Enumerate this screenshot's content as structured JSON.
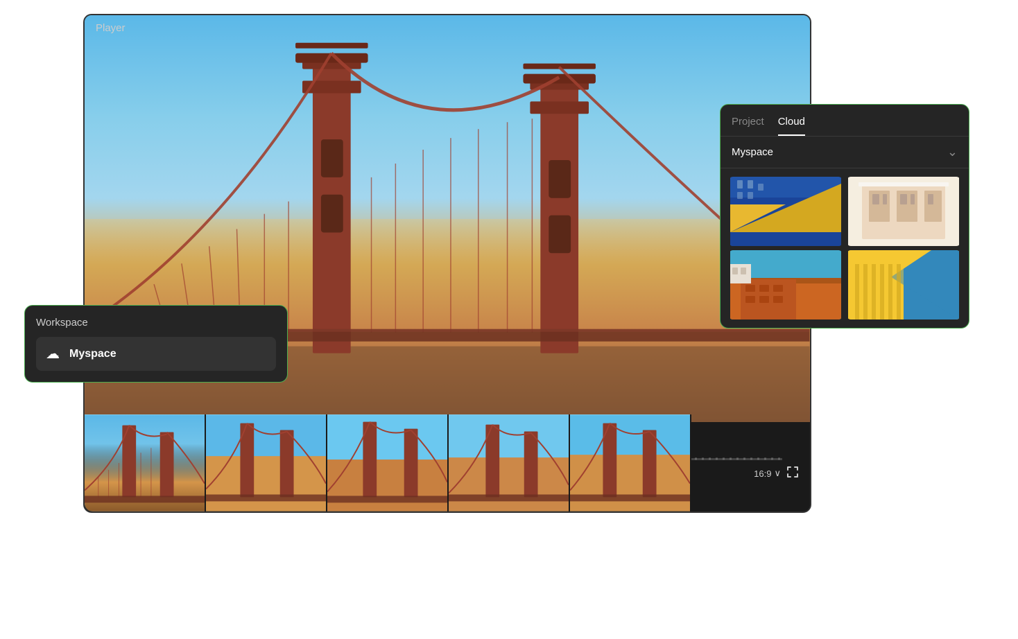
{
  "player": {
    "label": "Player"
  },
  "workspace_popup": {
    "title": "Workspace",
    "item_name": "Myspace",
    "item_icon": "☁"
  },
  "cloud_panel": {
    "tab_project": "Project",
    "tab_cloud": "Cloud",
    "dropdown_label": "Myspace",
    "dropdown_arrow": "⌄"
  },
  "timeline": {
    "aspect_ratio": "16:9",
    "aspect_chevron": "∨"
  },
  "thumbnails": [
    {
      "id": 1,
      "type": "thumb-1"
    },
    {
      "id": 2,
      "type": "thumb-2"
    },
    {
      "id": 3,
      "type": "thumb-3"
    },
    {
      "id": 4,
      "type": "thumb-4"
    }
  ]
}
